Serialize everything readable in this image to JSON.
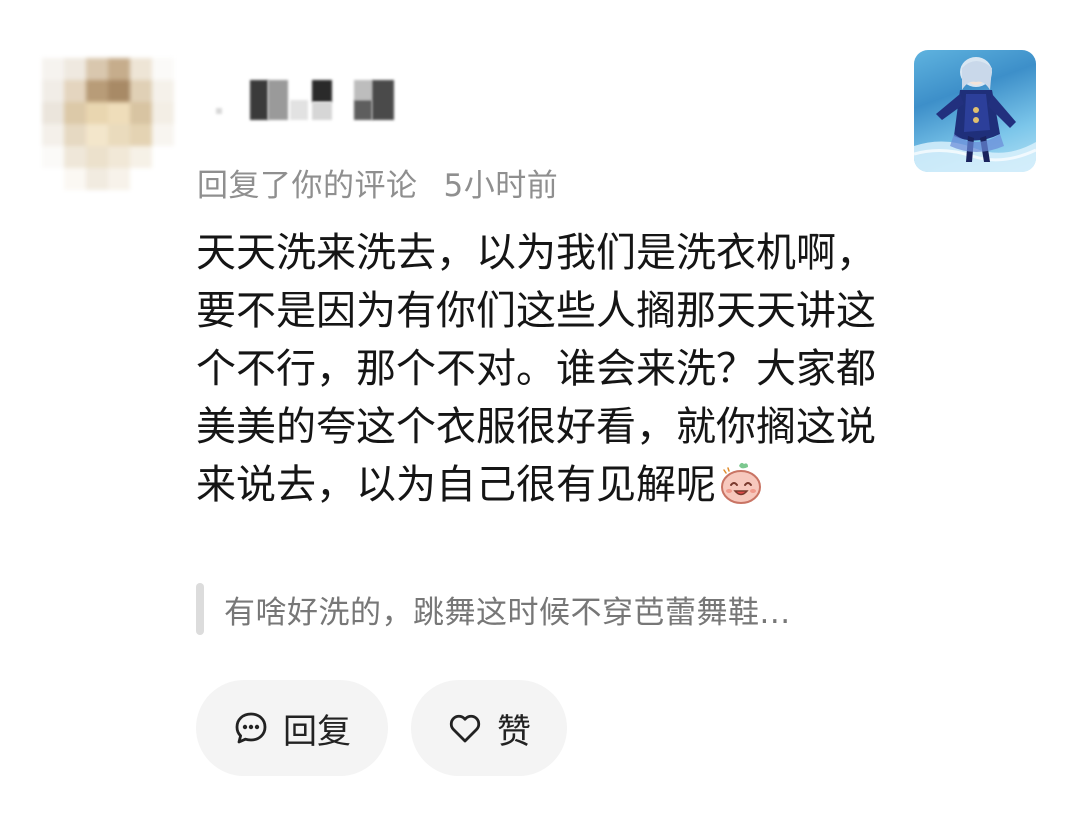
{
  "comment_card": {
    "reply_action": "回复了你的评论",
    "time_ago": "5小时前",
    "content": "天天洗来洗去，以为我们是洗衣机啊，要不是因为有你们这些人搁那天天讲这个不行，那个不对。谁会来洗？大家都美美的夸这个衣服很好看，就你搁这说来说去，以为自己很有见解呢",
    "quoted_comment": "有啥好洗的，跳舞这时候不穿芭蕾舞鞋...",
    "buttons": {
      "reply": "回复",
      "like": "赞"
    }
  },
  "icons": {
    "reply": "chat-bubble-icon",
    "like": "heart-outline-icon",
    "emoji": "smiling-bun-emoji"
  },
  "colors": {
    "meta_text": "#8f8f8f",
    "quote_text": "#777777",
    "button_bg": "#f4f4f4"
  }
}
